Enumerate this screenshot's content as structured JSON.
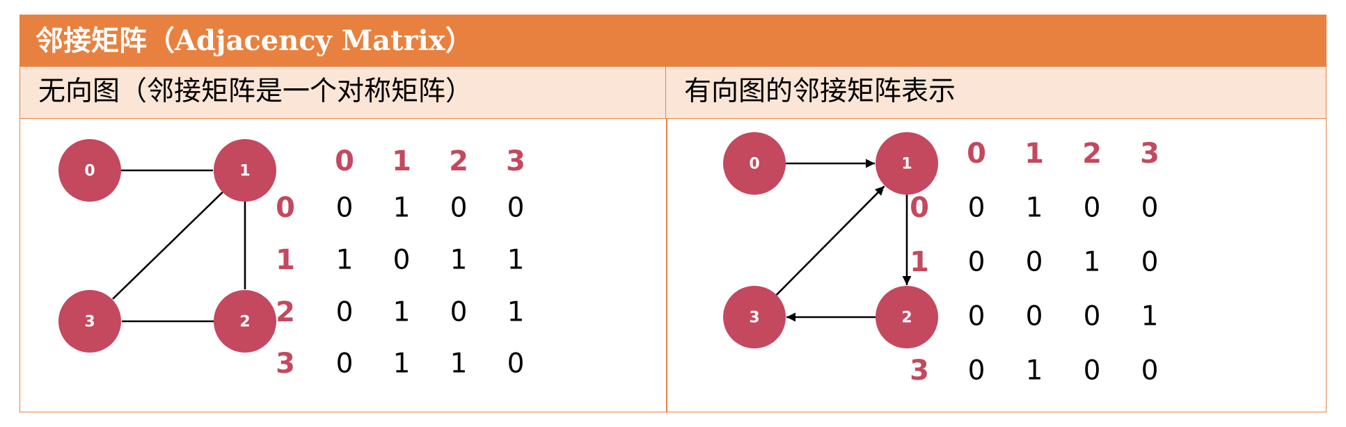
{
  "title": "邻接矩阵（Adjacency Matrix）",
  "colors": {
    "accent": "#E8813F",
    "header_bg": "#FBE5D6",
    "node": "#C4485E"
  },
  "panels": [
    {
      "heading": "无向图（邻接矩阵是一个对称矩阵）",
      "directed": false,
      "nodes": [
        "0",
        "1",
        "2",
        "3"
      ],
      "edges": [
        [
          "0",
          "1"
        ],
        [
          "1",
          "2"
        ],
        [
          "1",
          "3"
        ],
        [
          "2",
          "3"
        ]
      ],
      "matrix": {
        "labels": [
          "0",
          "1",
          "2",
          "3"
        ],
        "rows": [
          [
            "0",
            "1",
            "0",
            "0"
          ],
          [
            "1",
            "0",
            "1",
            "1"
          ],
          [
            "0",
            "1",
            "0",
            "1"
          ],
          [
            "0",
            "1",
            "1",
            "0"
          ]
        ]
      }
    },
    {
      "heading": "有向图的邻接矩阵表示",
      "directed": true,
      "nodes": [
        "0",
        "1",
        "2",
        "3"
      ],
      "edges": [
        [
          "0",
          "1"
        ],
        [
          "1",
          "2"
        ],
        [
          "2",
          "3"
        ],
        [
          "3",
          "1"
        ]
      ],
      "matrix": {
        "labels": [
          "0",
          "1",
          "2",
          "3"
        ],
        "rows": [
          [
            "0",
            "1",
            "0",
            "0"
          ],
          [
            "0",
            "0",
            "1",
            "0"
          ],
          [
            "0",
            "0",
            "0",
            "1"
          ],
          [
            "0",
            "1",
            "0",
            "0"
          ]
        ]
      }
    }
  ]
}
